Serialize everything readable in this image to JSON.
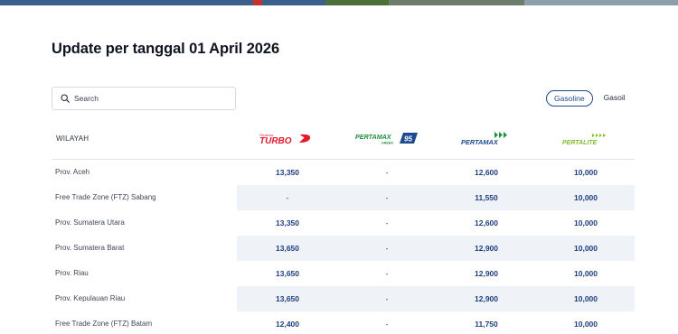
{
  "page": {
    "title": "Update per tanggal 01 April 2026"
  },
  "search": {
    "placeholder": "Search"
  },
  "fuel_tabs": [
    {
      "label": "Gasoline",
      "active": true
    },
    {
      "label": "Gasoil",
      "active": false
    }
  ],
  "table": {
    "region_header": "WILAYAH",
    "products": [
      {
        "name": "Pertamax Turbo",
        "logo_text": "TURBO",
        "logo_small_text": "Pertamax",
        "color": "#e3192d"
      },
      {
        "name": "Pertamax Green 95",
        "logo_text": "PERTAMAX",
        "logo_small_text": "GREEN",
        "badge": "95",
        "color": "#1f8f3a"
      },
      {
        "name": "Pertamax",
        "logo_text": "PERTAMAX",
        "color": "#1d4a8f"
      },
      {
        "name": "Pertalite",
        "logo_text": "PERTALITE",
        "color": "#7dbf2e"
      }
    ],
    "rows": [
      {
        "region": "Prov. Aceh",
        "values": [
          "13,350",
          "-",
          "12,600",
          "10,000"
        ]
      },
      {
        "region": "Free Trade Zone (FTZ) Sabang",
        "values": [
          "-",
          "-",
          "11,550",
          "10,000"
        ]
      },
      {
        "region": "Prov. Sumatera Utara",
        "values": [
          "13,350",
          "-",
          "12,600",
          "10,000"
        ]
      },
      {
        "region": "Prov. Sumatera Barat",
        "values": [
          "13,650",
          "-",
          "12,900",
          "10,000"
        ]
      },
      {
        "region": "Prov. Riau",
        "values": [
          "13,650",
          "-",
          "12,900",
          "10,000"
        ]
      },
      {
        "region": "Prov. Kepulauan Riau",
        "values": [
          "13,650",
          "-",
          "12,900",
          "10,000"
        ]
      },
      {
        "region": "Free Trade Zone (FTZ) Batam",
        "values": [
          "12,400",
          "-",
          "11,750",
          "10,000"
        ]
      }
    ]
  },
  "colors": {
    "accent": "#1d4a8f",
    "value_text": "#1d3f80",
    "row_shade": "#eff2f7"
  }
}
